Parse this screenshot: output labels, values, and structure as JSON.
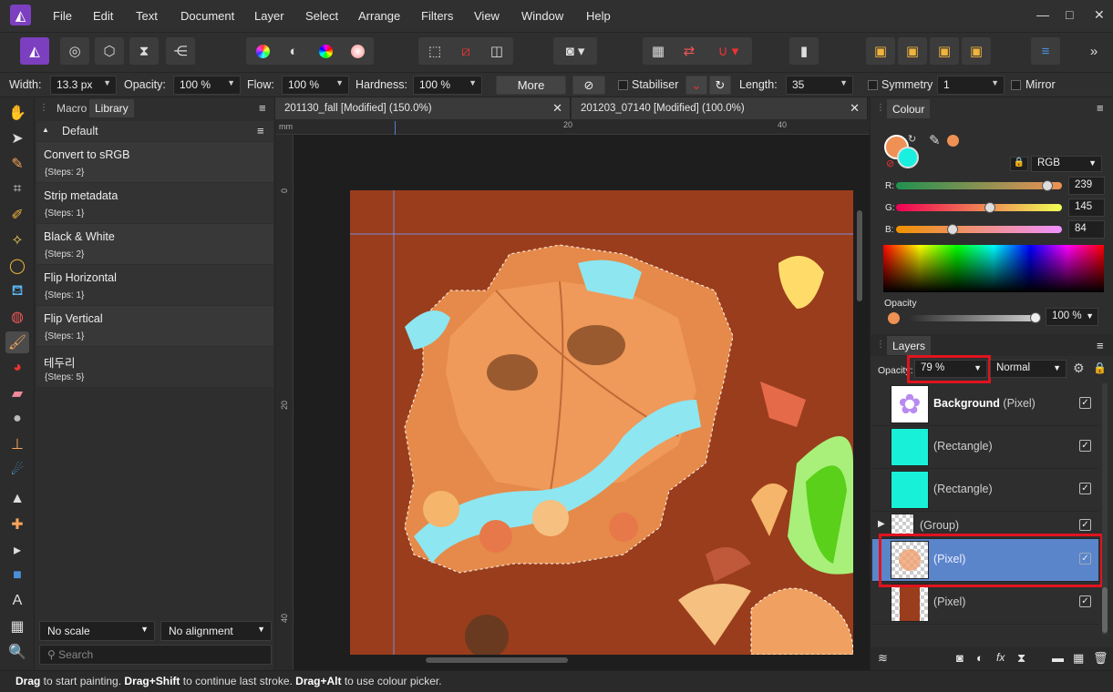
{
  "menu": [
    "File",
    "Edit",
    "Text",
    "Document",
    "Layer",
    "Select",
    "Arrange",
    "Filters",
    "View",
    "Window",
    "Help"
  ],
  "window_controls": {
    "minimize": "—",
    "maximize": "□",
    "close": "✕"
  },
  "context": {
    "width_label": "Width:",
    "width_value": "13.3 px",
    "opacity_label": "Opacity:",
    "opacity_value": "100 %",
    "flow_label": "Flow:",
    "flow_value": "100 %",
    "hardness_label": "Hardness:",
    "hardness_value": "100 %",
    "more_label": "More",
    "stabiliser_label": "Stabiliser",
    "length_label": "Length:",
    "length_value": "35",
    "symmetry_label": "Symmetry",
    "symmetry_value": "1",
    "mirror_label": "Mirror"
  },
  "left_panel": {
    "tabs": [
      "Macro",
      "Library"
    ],
    "active_tab": "Library",
    "category": "Default",
    "macros": [
      {
        "name": "Convert to sRGB",
        "steps": "{Steps: 2}"
      },
      {
        "name": "Strip metadata",
        "steps": "{Steps: 1}"
      },
      {
        "name": "Black & White",
        "steps": "{Steps: 2}"
      },
      {
        "name": "Flip Horizontal",
        "steps": "{Steps: 1}"
      },
      {
        "name": "Flip Vertical",
        "steps": "{Steps: 1}"
      },
      {
        "name": "테두리",
        "steps": "{Steps: 5}"
      }
    ],
    "scale_select": "No scale",
    "alignment_select": "No alignment",
    "search_placeholder": "Search"
  },
  "doc_tabs": [
    {
      "title": "201130_fall [Modified] (150.0%)",
      "close": "✕"
    },
    {
      "title": "201203_07140 [Modified] (100.0%)",
      "close": "✕"
    }
  ],
  "rulers": {
    "unit": "mm",
    "top": [
      "20",
      "40"
    ],
    "left": [
      "0",
      "20",
      "40"
    ]
  },
  "colour_panel": {
    "title": "Colour",
    "model": "RGB",
    "r_label": "R:",
    "r_value": "239",
    "g_label": "G:",
    "g_value": "145",
    "b_label": "B:",
    "b_value": "84",
    "primary_color": "#ef9154",
    "secondary_color": "#19f0e0",
    "opacity_label": "Opacity",
    "opacity_value": "100 %"
  },
  "layers_panel": {
    "title": "Layers",
    "opacity_label": "Opacity:",
    "opacity_value": "79 %",
    "blend_mode": "Normal",
    "layers": [
      {
        "name": "Background",
        "type": "(Pixel)",
        "bold": true,
        "selected": false
      },
      {
        "name": "",
        "type": "(Rectangle)",
        "bold": false,
        "selected": false
      },
      {
        "name": "",
        "type": "(Rectangle)",
        "bold": false,
        "selected": false
      },
      {
        "name": "",
        "type": "(Group)",
        "bold": false,
        "selected": false
      },
      {
        "name": "",
        "type": "(Pixel)",
        "bold": false,
        "selected": true
      },
      {
        "name": "",
        "type": "(Pixel)",
        "bold": false,
        "selected": false
      }
    ]
  },
  "status": {
    "drag": "Drag",
    "t1": " to start painting. ",
    "drag_shift": "Drag+Shift",
    "t2": " to continue last stroke. ",
    "drag_alt": "Drag+Alt",
    "t3": " to use colour picker."
  },
  "colors": {
    "canvas_bg": "#9a3d1c",
    "selection": "#5b85cb",
    "highlight": "#e0141e"
  }
}
